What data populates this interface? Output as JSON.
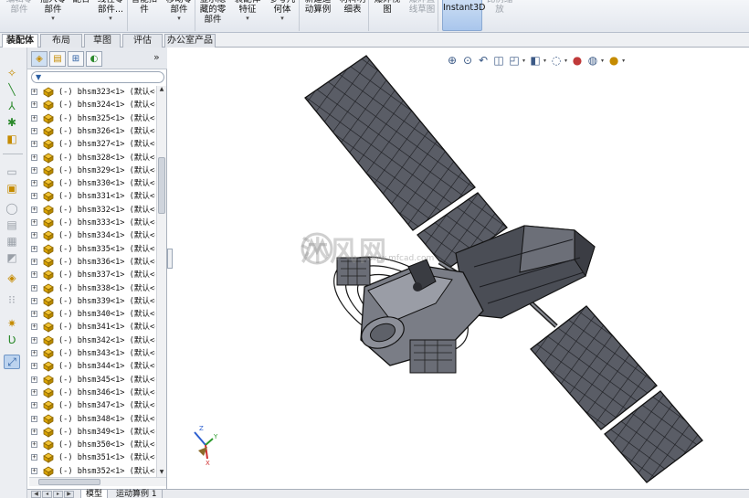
{
  "ribbon": [
    {
      "label": "编辑零\n部件",
      "dropdown": false,
      "enabled": false
    },
    {
      "label": "插入零\n部件",
      "dropdown": true,
      "enabled": true
    },
    {
      "label": "配合",
      "dropdown": false,
      "enabled": true
    },
    {
      "label": "线性零\n部件...",
      "dropdown": true,
      "enabled": true
    },
    {
      "label": "智能扣\n件",
      "dropdown": false,
      "enabled": true
    },
    {
      "label": "移动零\n部件",
      "dropdown": true,
      "enabled": true
    },
    {
      "label": "显示隐\n藏的零\n部件",
      "dropdown": false,
      "enabled": true
    },
    {
      "label": "装配体\n特征",
      "dropdown": true,
      "enabled": true
    },
    {
      "label": "参考几\n何体",
      "dropdown": true,
      "enabled": true
    },
    {
      "label": "新建运\n动算例",
      "dropdown": false,
      "enabled": true
    },
    {
      "label": "材料明\n细表",
      "dropdown": false,
      "enabled": true
    },
    {
      "label": "爆炸视\n图",
      "dropdown": false,
      "enabled": true
    },
    {
      "label": "爆炸直\n线草图",
      "dropdown": false,
      "enabled": false
    },
    {
      "label": "Instant3D",
      "dropdown": false,
      "enabled": true,
      "active": true
    },
    {
      "label": "比例缩\n放",
      "dropdown": false,
      "enabled": false
    }
  ],
  "tabs": [
    "装配体",
    "布局",
    "草图",
    "评估",
    "办公室产品"
  ],
  "active_tab": "装配体",
  "filter_label": "▼",
  "tree": {
    "prefix": "(-)",
    "config_suffix": "(默认<<",
    "items": [
      "bhsm323<1>",
      "bhsm324<1>",
      "bhsm325<1>",
      "bhsm326<1>",
      "bhsm327<1>",
      "bhsm328<1>",
      "bhsm329<1>",
      "bhsm330<1>",
      "bhsm331<1>",
      "bhsm332<1>",
      "bhsm333<1>",
      "bhsm334<1>",
      "bhsm335<1>",
      "bhsm336<1>",
      "bhsm337<1>",
      "bhsm338<1>",
      "bhsm339<1>",
      "bhsm340<1>",
      "bhsm341<1>",
      "bhsm342<1>",
      "bhsm343<1>",
      "bhsm344<1>",
      "bhsm345<1>",
      "bhsm346<1>",
      "bhsm347<1>",
      "bhsm348<1>",
      "bhsm349<1>",
      "bhsm350<1>",
      "bhsm351<1>",
      "bhsm352<1>"
    ]
  },
  "bottom_tabs": [
    "模型",
    "运动算例 1"
  ],
  "watermark": {
    "text": "沐风网",
    "sub": "www.mfcad.com"
  },
  "panel_expand": "»"
}
